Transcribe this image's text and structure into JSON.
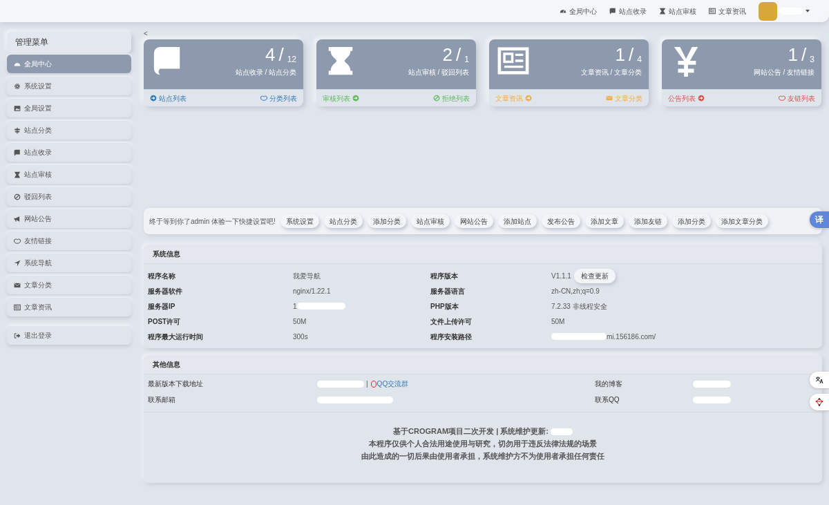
{
  "navbar": {
    "links": [
      {
        "label": "全局中心"
      },
      {
        "label": "站点收录"
      },
      {
        "label": "站点审核"
      },
      {
        "label": "文章资讯"
      }
    ],
    "user": {
      "name_redacted": true,
      "dropdown": true
    }
  },
  "sidebar": {
    "title": "管理菜单",
    "items": [
      {
        "label": "全局中心",
        "selected": true
      },
      {
        "label": "系统设置",
        "selected": false
      },
      {
        "label": "全局设置",
        "selected": false
      },
      {
        "label": "站点分类",
        "selected": false
      },
      {
        "label": "站点收录",
        "selected": false
      },
      {
        "label": "站点审核",
        "selected": false
      },
      {
        "label": "驳回列表",
        "selected": false
      },
      {
        "label": "网站公告",
        "selected": false
      },
      {
        "label": "友情链接",
        "selected": false
      },
      {
        "label": "系统导航",
        "selected": false
      },
      {
        "label": "文章分类",
        "selected": false
      },
      {
        "label": "文章资讯",
        "selected": false
      }
    ],
    "logout": {
      "label": "退出登录"
    }
  },
  "back": "<",
  "stats": [
    {
      "value": "4",
      "divider": "/",
      "total": "12",
      "subtitle": "站点收录 / 站点分类",
      "color": "#337ab7",
      "left": {
        "label": "站点列表",
        "icon_first": true
      },
      "right": {
        "label": "分类列表",
        "icon_first": true
      }
    },
    {
      "value": "2",
      "divider": "/",
      "total": "1",
      "subtitle": "站点审核 / 驳回列表",
      "color": "#5cb85c",
      "left": {
        "label": "审核列表",
        "icon_first": false
      },
      "right": {
        "label": "拒绝列表",
        "icon_first": true
      }
    },
    {
      "value": "1",
      "divider": "/",
      "total": "4",
      "subtitle": "文章资讯 / 文章分类",
      "color": "#f0ad4e",
      "left": {
        "label": "文章资讯",
        "icon_first": false
      },
      "right": {
        "label": "文章分类",
        "icon_first": true
      }
    },
    {
      "value": "1",
      "divider": "/",
      "total": "3",
      "subtitle": "网站公告 / 友情链接",
      "color": "#d9534f",
      "left": {
        "label": "公告列表",
        "icon_first": false
      },
      "right": {
        "label": "友链列表",
        "icon_first": true
      }
    }
  ],
  "quick": {
    "intro_before": "终于等到你了",
    "intro_link": "admin",
    "intro_after": "体验一下快捷设置吧!",
    "buttons": [
      "系统设置",
      "站点分类",
      "添加分类",
      "站点审核",
      "网站公告",
      "添加站点",
      "发布公告",
      "添加文章",
      "添加友链",
      "添加分类",
      "添加文章分类"
    ]
  },
  "system_info": {
    "title": "系统信息",
    "rows": [
      {
        "label": "程序名称",
        "value": "我爱导航",
        "label2": "程序版本",
        "value2": "V1.1.1",
        "button2": "检查更新"
      },
      {
        "label": "服务器软件",
        "value": "nginx/1.22.1",
        "label2": "服务器语言",
        "value2": "zh-CN,zh;q=0.9"
      },
      {
        "label": "服务器IP",
        "value": "1",
        "value_redacted": true,
        "label2": "PHP版本",
        "value2": "7.2.33 非线程安全"
      },
      {
        "label": "POST许可",
        "value": "50M",
        "label2": "文件上传许可",
        "value2": "50M"
      },
      {
        "label": "程序最大运行时间",
        "value": "300s",
        "label2": "程序安装路径",
        "value2": "mi.156186.com/",
        "value2_redacted": true
      }
    ]
  },
  "other_info": {
    "title": "其他信息",
    "rows": [
      {
        "label": "最新版本下载地址",
        "value_redacted": true,
        "separator": "|",
        "link": "QQ交流群",
        "label2": "我的博客",
        "value2_redacted": true
      },
      {
        "label": "联系邮箱",
        "value_redacted": true,
        "label2": "联系QQ",
        "value2_redacted": true
      }
    ]
  },
  "footer": {
    "lines": [
      "基于CROGRAM项目二次开发 | 系统维护更新:",
      "本程序仅供个人合法用途使用与研究，切勿用于违反法律法规的场景",
      "由此造成的一切后果由使用者承担，系统维护方不为使用者承担任何责任"
    ],
    "first_line_redacted": true
  },
  "float_buttons": [
    {
      "kind": "text",
      "label": "译"
    },
    {
      "kind": "translate"
    },
    {
      "kind": "network"
    }
  ]
}
